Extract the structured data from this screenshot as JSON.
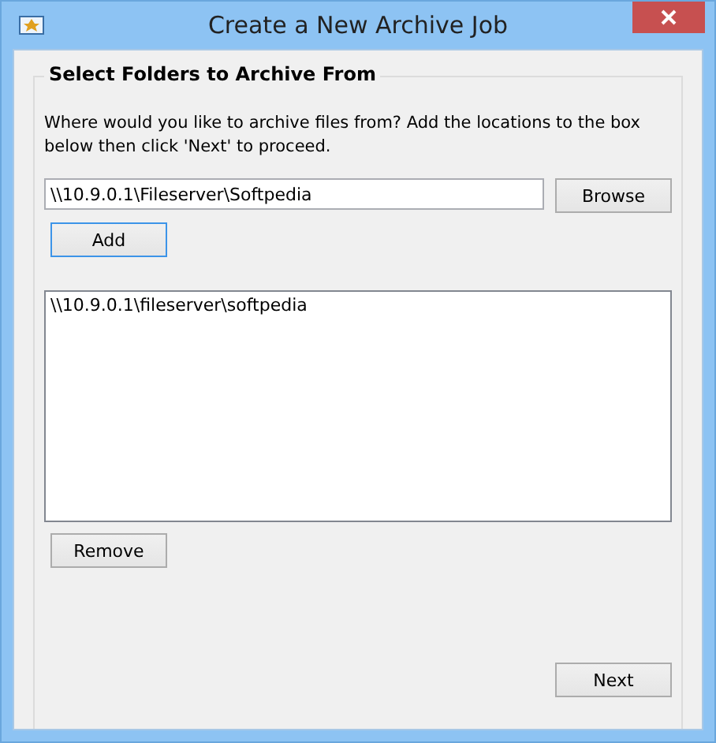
{
  "window": {
    "title": "Create a New Archive Job"
  },
  "group": {
    "title": "Select Folders to Archive From"
  },
  "instructions": "Where would you like to archive files from? Add the locations to the box below then click 'Next' to proceed.",
  "path_field": {
    "value": "\\\\10.9.0.1\\Fileserver\\Softpedia"
  },
  "browse_button": {
    "label": "Browse",
    "focused": false
  },
  "add_button": {
    "label": "Add",
    "focused": true
  },
  "folder_list": {
    "items": [
      {
        "label": "\\\\10.9.0.1\\fileserver\\softpedia",
        "selected": false
      }
    ]
  },
  "remove_button": {
    "label": "Remove",
    "focused": false
  },
  "next_button": {
    "label": "Next",
    "focused": false
  }
}
